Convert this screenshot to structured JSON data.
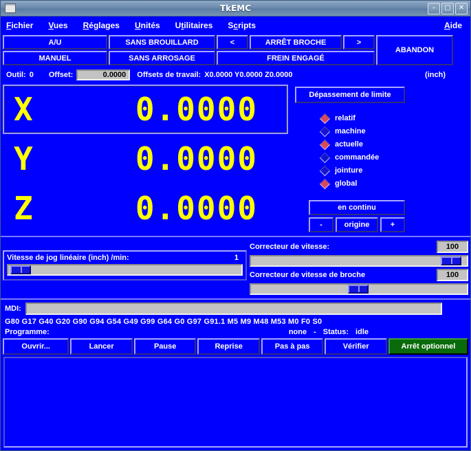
{
  "window": {
    "title": "TkEMC",
    "icon": "window-icon",
    "controls": {
      "minimize": "–",
      "maximize": "□",
      "close": "✕"
    }
  },
  "menubar": {
    "items": [
      {
        "label": "Fichier",
        "mnemonic": "F"
      },
      {
        "label": "Vues",
        "mnemonic": "V"
      },
      {
        "label": "Réglages",
        "mnemonic": "R"
      },
      {
        "label": "Unités",
        "mnemonic": "U"
      },
      {
        "label": "Utilitaires",
        "mnemonic": "t"
      },
      {
        "label": "Scripts",
        "mnemonic": "c"
      }
    ],
    "help": {
      "label": "Aide",
      "mnemonic": "A"
    }
  },
  "toolbar": {
    "estop": "A/U",
    "mode": "MANUEL",
    "mist": "SANS BROUILLARD",
    "flood": "SANS ARROSAGE",
    "spindle_prev": "<",
    "spindle": "ARRÊT BROCHE",
    "spindle_next": ">",
    "brake": "FREIN ENGAGÉ",
    "abort": "ABANDON"
  },
  "status": {
    "tool_label": "Outil:",
    "tool_value": "0",
    "offset_label": "Offset:",
    "offset_value": "0.0000",
    "work_offsets_label": "Offsets de travail:",
    "work_offsets_value": "X0.0000 Y0.0000 Z0.0000",
    "units": "(inch)"
  },
  "dro": {
    "axes": [
      {
        "name": "X",
        "value": "0.0000",
        "selected": true
      },
      {
        "name": "Y",
        "value": "0.0000",
        "selected": false
      },
      {
        "name": "Z",
        "value": "0.0000",
        "selected": false
      }
    ]
  },
  "right_panel": {
    "limit_button": "Dépassement de limite",
    "radios": [
      {
        "label": "relatif",
        "selected": true
      },
      {
        "label": "machine",
        "selected": false
      },
      {
        "label": "actuelle",
        "selected": true
      },
      {
        "label": "commandée",
        "selected": false
      },
      {
        "label": "jointure",
        "selected": false
      },
      {
        "label": "global",
        "selected": true
      }
    ],
    "jog_mode": "en continu",
    "jog_minus": "-",
    "jog_home": "origine",
    "jog_plus": "+"
  },
  "jog_speed": {
    "label": "Vitesse de jog linéaire   (inch)  /min:",
    "value": "1",
    "thumb_percent": 1
  },
  "overrides": {
    "feed": {
      "label": "Correcteur de vitesse:",
      "value": "100",
      "thumb_percent": 88
    },
    "spindle": {
      "label": "Correcteur de vitesse de broche",
      "value": "100",
      "thumb_percent": 45
    }
  },
  "mdi": {
    "label": "MDI:",
    "value": "",
    "placeholder": ""
  },
  "gcodes": "G80 G17 G40 G20 G90 G94 G54 G49 G99 G64 G0 G97 G91.1 M5 M9 M48 M53 M0 F0 S0",
  "program": {
    "label": "Programme:",
    "file": "none",
    "separator": "-",
    "status_label": "Status:",
    "status_value": "idle"
  },
  "buttons": {
    "open": "Ouvrir...",
    "run": "Lancer",
    "pause": "Pause",
    "resume": "Reprise",
    "step": "Pas à pas",
    "verify": "Vérifier",
    "optional_stop": "Arrêt optionnel"
  },
  "colors": {
    "background": "#0000ff",
    "dro_text": "#ffff00",
    "titlebar": "#6e8cae",
    "optional_stop": "#0a6b0a",
    "entry": "#c3c3c3",
    "radio_on": "#d84a5a"
  }
}
